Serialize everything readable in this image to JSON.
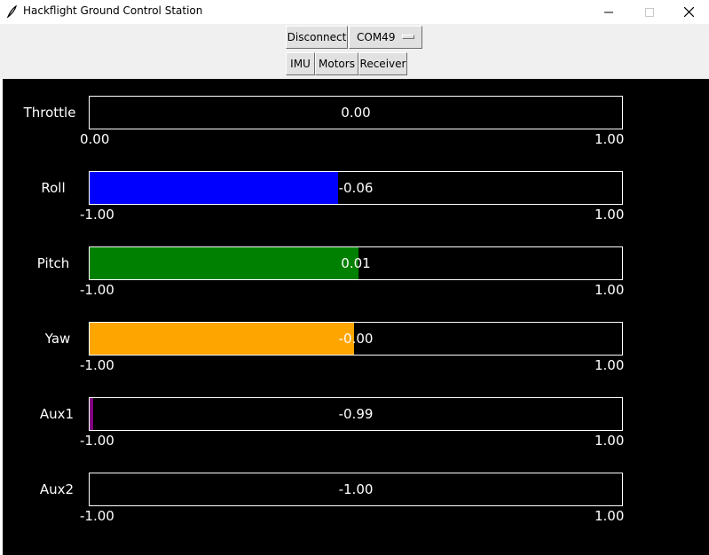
{
  "window": {
    "title": "Hackflight Ground Control Station",
    "controls": [
      "minimize-icon",
      "maximize-icon",
      "close-icon"
    ]
  },
  "toolbar": {
    "connect_label": "Disconnect",
    "port_value": "COM49",
    "tabs": [
      {
        "label": "IMU"
      },
      {
        "label": "Motors"
      },
      {
        "label": "Receiver"
      }
    ]
  },
  "receiver": {
    "channels": [
      {
        "label": "Throttle",
        "value": "0.00",
        "min": "0.00",
        "max": "1.00",
        "fill": 0,
        "color": "#000000"
      },
      {
        "label": "Roll",
        "value": "-0.06",
        "min": "-1.00",
        "max": "1.00",
        "fill": 0.467,
        "color": "#0000ff"
      },
      {
        "label": "Pitch",
        "value": "0.01",
        "min": "-1.00",
        "max": "1.00",
        "fill": 0.505,
        "color": "#008000"
      },
      {
        "label": "Yaw",
        "value": "-0.00",
        "min": "-1.00",
        "max": "1.00",
        "fill": 0.497,
        "color": "#ffa500"
      },
      {
        "label": "Aux1",
        "value": "-0.99",
        "min": "-1.00",
        "max": "1.00",
        "fill": 0.006,
        "color": "#800080"
      },
      {
        "label": "Aux2",
        "value": "-1.00",
        "min": "-1.00",
        "max": "1.00",
        "fill": 0,
        "color": "#000000"
      }
    ]
  }
}
